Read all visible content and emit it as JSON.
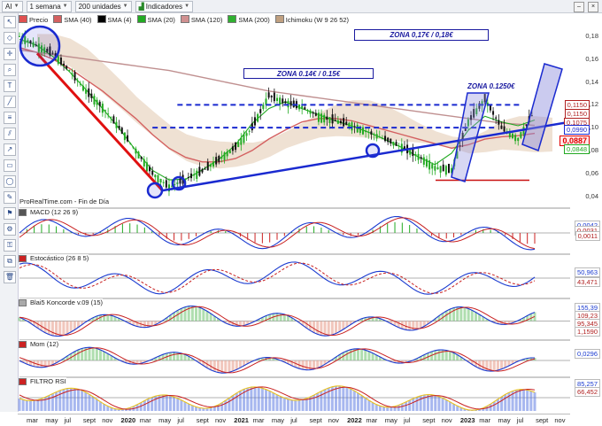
{
  "toolbar": {
    "symbol": "AI",
    "period": "1 semana",
    "units": "200 unidades",
    "indicators": "Indicadores"
  },
  "legend": [
    {
      "label": "Precio",
      "color": "#e05050"
    },
    {
      "label": "SMA (40)",
      "color": "#d46060"
    },
    {
      "label": "SMA (4)",
      "color": "#000000"
    },
    {
      "label": "SMA (20)",
      "color": "#22aa22"
    },
    {
      "label": "SMA (120)",
      "color": "#d09090"
    },
    {
      "label": "SMA (200)",
      "color": "#30b030"
    },
    {
      "label": "Ichimoku (W 9 26 52)",
      "color": "#c0a080"
    }
  ],
  "credit": "ProRealTime.com - Fin de Día",
  "annotations": {
    "zone1": "ZONA 0,17€ / 0,18€",
    "zone2": "ZONA 0.14€ / 0.15€",
    "zone3": "ZONA 0.1250€"
  },
  "panels": {
    "macd": "MACD (12 26 9)",
    "stoch": "Estocástico (26 8 5)",
    "koncorde": "Blai5 Koncorde v.09 (15)",
    "mom": "Mom (12)",
    "rsi": "FILTRO RSI"
  },
  "colors": {
    "bull": "#22aa22",
    "bear": "#cc2222",
    "trend": "#1a2ad0",
    "downtrend": "#e01010"
  },
  "price_tags": [
    {
      "text": "0,1150",
      "color": "#b02020",
      "bg": "#ffffff"
    },
    {
      "text": "0,1150",
      "color": "#b02020",
      "bg": "#ffffff"
    },
    {
      "text": "0,1075",
      "color": "#b02020",
      "bg": "#ffffff"
    },
    {
      "text": "0,0990",
      "color": "#1a2ad0",
      "bg": "#ffffff"
    },
    {
      "text": "0,0887",
      "color": "#e00000",
      "bg": "#ffe8e8"
    },
    {
      "text": "0,0848",
      "color": "#22aa22",
      "bg": "#ffffff"
    }
  ],
  "indicator_tags": {
    "macd": [
      "0,0042",
      "0,0031",
      "0,0011"
    ],
    "stoch": [
      "50,963",
      "43,471"
    ],
    "koncorde": [
      "155,39",
      "109,23",
      "95,345",
      "1,1590"
    ],
    "mom": [
      "0,0296"
    ],
    "rsi": [
      "85,257",
      "66,452"
    ]
  },
  "chart_data": {
    "type": "line",
    "title": "",
    "xlabel": "",
    "ylabel": "",
    "ylim": [
      0.035,
      0.19
    ],
    "yticks": [
      0.18,
      0.16,
      0.14,
      0.12,
      0.1,
      0.08,
      0.06,
      0.04
    ],
    "xticks": [
      "mar",
      "may",
      "jul",
      "sept",
      "nov",
      "2020",
      "mar",
      "may",
      "jul",
      "sept",
      "nov",
      "2021",
      "mar",
      "may",
      "jul",
      "sept",
      "nov",
      "2022",
      "mar",
      "may",
      "jul",
      "sept",
      "nov",
      "2023",
      "mar",
      "may",
      "jul",
      "sept",
      "nov"
    ],
    "series": [
      {
        "name": "Precio",
        "values": [
          0.18,
          0.172,
          0.165,
          0.15,
          0.132,
          0.118,
          0.1,
          0.08,
          0.06,
          0.048,
          0.055,
          0.062,
          0.072,
          0.083,
          0.1,
          0.128,
          0.122,
          0.118,
          0.11,
          0.106,
          0.102,
          0.096,
          0.09,
          0.083,
          0.075,
          0.065,
          0.063,
          0.105,
          0.125,
          0.1,
          0.09,
          0.115
        ]
      },
      {
        "name": "SMA (40)",
        "values": [
          0.17,
          0.166,
          0.16,
          0.152,
          0.142,
          0.132,
          0.12,
          0.108,
          0.094,
          0.082,
          0.074,
          0.07,
          0.07,
          0.073,
          0.08,
          0.09,
          0.098,
          0.105,
          0.108,
          0.108,
          0.106,
          0.102,
          0.098,
          0.094,
          0.09,
          0.086,
          0.082,
          0.085,
          0.09,
          0.092,
          0.093,
          0.095
        ]
      },
      {
        "name": "SMA (200)",
        "values": [
          0.168,
          0.166,
          0.164,
          0.162,
          0.16,
          0.158,
          0.156,
          0.154,
          0.152,
          0.15,
          0.147,
          0.144,
          0.141,
          0.138,
          0.135,
          0.132,
          0.13,
          0.128,
          0.126,
          0.124,
          0.122,
          0.12,
          0.118,
          0.116,
          0.114,
          0.112,
          0.11,
          0.108,
          0.106,
          0.104,
          0.103,
          0.102
        ]
      }
    ],
    "downtrend_line": {
      "from": [
        0,
        0.165
      ],
      "to": [
        8.6,
        0.045
      ]
    },
    "uptrend_line": {
      "from": [
        8.6,
        0.045
      ],
      "to": [
        31,
        0.1
      ]
    },
    "resistance_dashed": 0.12,
    "support_dashed": 0.1,
    "grid": false,
    "legend_position": "top-left"
  }
}
